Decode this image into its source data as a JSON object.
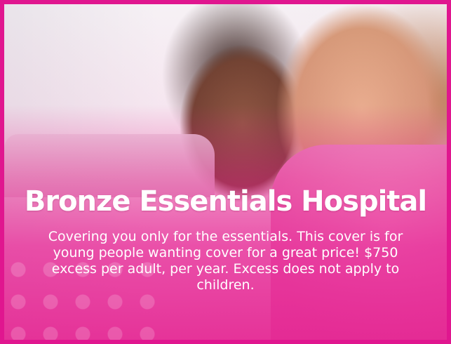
{
  "card": {
    "title": "Bronze Essentials Hospital",
    "description": "Covering you only for the essentials. This cover is for young people wanting cover for a great price! $750 excess per adult, per year. Excess does not apply to children."
  },
  "colors": {
    "accent": "#e0168f",
    "overlay": "#e9238c",
    "text": "#ffffff"
  }
}
